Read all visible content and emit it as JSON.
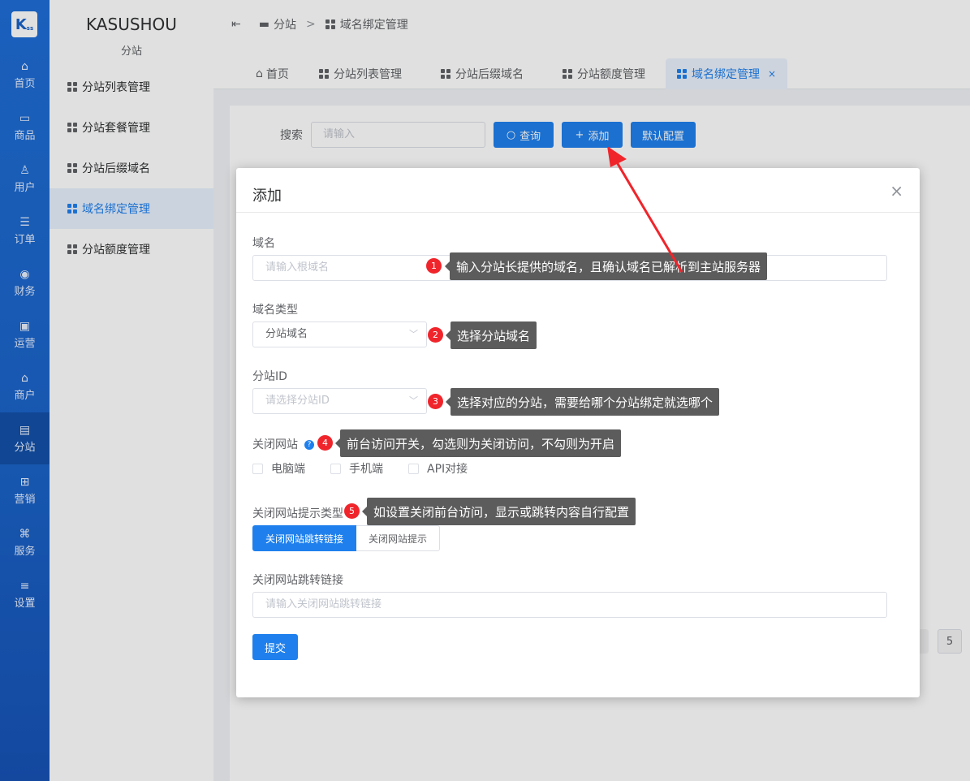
{
  "rail": {
    "logo": "K",
    "logo_sub": "ss",
    "items": [
      {
        "label": "首页",
        "icon": "home-icon",
        "glyph": "⌂"
      },
      {
        "label": "商品",
        "icon": "box-icon",
        "glyph": "▭"
      },
      {
        "label": "用户",
        "icon": "user-icon",
        "glyph": "♙"
      },
      {
        "label": "订单",
        "icon": "order-icon",
        "glyph": "☰"
      },
      {
        "label": "财务",
        "icon": "finance-icon",
        "glyph": "◉"
      },
      {
        "label": "运营",
        "icon": "operation-icon",
        "glyph": "▣"
      },
      {
        "label": "商户",
        "icon": "shop-icon",
        "glyph": "⌂"
      },
      {
        "label": "分站",
        "icon": "substation-icon",
        "glyph": "▤"
      },
      {
        "label": "营销",
        "icon": "gift-icon",
        "glyph": "⊞"
      },
      {
        "label": "服务",
        "icon": "service-icon",
        "glyph": "⌘"
      },
      {
        "label": "设置",
        "icon": "settings-icon",
        "glyph": "≡"
      }
    ],
    "active_index": 7
  },
  "side": {
    "brand": "KASUSHOU",
    "brand_sub": "分站",
    "items": [
      "分站列表管理",
      "分站套餐管理",
      "分站后缀域名",
      "域名绑定管理",
      "分站额度管理"
    ],
    "active_index": 3
  },
  "breadcrumb": {
    "menu_icon": "⇤",
    "level1": "分站",
    "sep": ">",
    "level2": "域名绑定管理"
  },
  "tabs": [
    {
      "label": "首页",
      "icon": "home-icon"
    },
    {
      "label": "分站列表管理",
      "icon": "grid-icon"
    },
    {
      "label": "分站后缀域名",
      "icon": "grid-icon"
    },
    {
      "label": "分站额度管理",
      "icon": "grid-icon"
    },
    {
      "label": "域名绑定管理",
      "icon": "grid-icon",
      "closable": "×"
    }
  ],
  "toolbar": {
    "search_label": "搜索",
    "search_placeholder": "请输入",
    "query_btn": "查询",
    "add_btn": "添加",
    "default_btn": "默认配置"
  },
  "pagination": {
    "last_page": "5"
  },
  "dialog": {
    "title": "添加",
    "close": "×",
    "domain_label": "域名",
    "domain_placeholder": "请输入根域名",
    "type_label": "域名类型",
    "type_value": "分站域名",
    "id_label": "分站ID",
    "id_placeholder": "请选择分站ID",
    "close_site_label": "关闭网站",
    "close_site_options": [
      "电脑端",
      "手机端",
      "API对接"
    ],
    "prompt_type_label": "关闭网站提示类型",
    "prompt_type_options": [
      "关闭网站跳转链接",
      "关闭网站提示"
    ],
    "redirect_label": "关闭网站跳转链接",
    "redirect_placeholder": "请输入关闭网站跳转链接",
    "submit": "提交"
  },
  "annotations": [
    {
      "num": "1",
      "text": "输入分站长提供的域名，且确认域名已解析到主站服务器"
    },
    {
      "num": "2",
      "text": "选择分站域名"
    },
    {
      "num": "3",
      "text": "选择对应的分站，需要给哪个分站绑定就选哪个"
    },
    {
      "num": "4",
      "text": "前台访问开关，勾选则为关闭访问，不勾则为开启"
    },
    {
      "num": "5",
      "text": "如设置关闭前台访问，显示或跳转内容自行配置"
    }
  ],
  "colors": {
    "primary": "#1f80ed",
    "rail": "#1b63c8",
    "annotation_badge": "#f0252b",
    "annotation_tip": "#5c5c5c"
  }
}
